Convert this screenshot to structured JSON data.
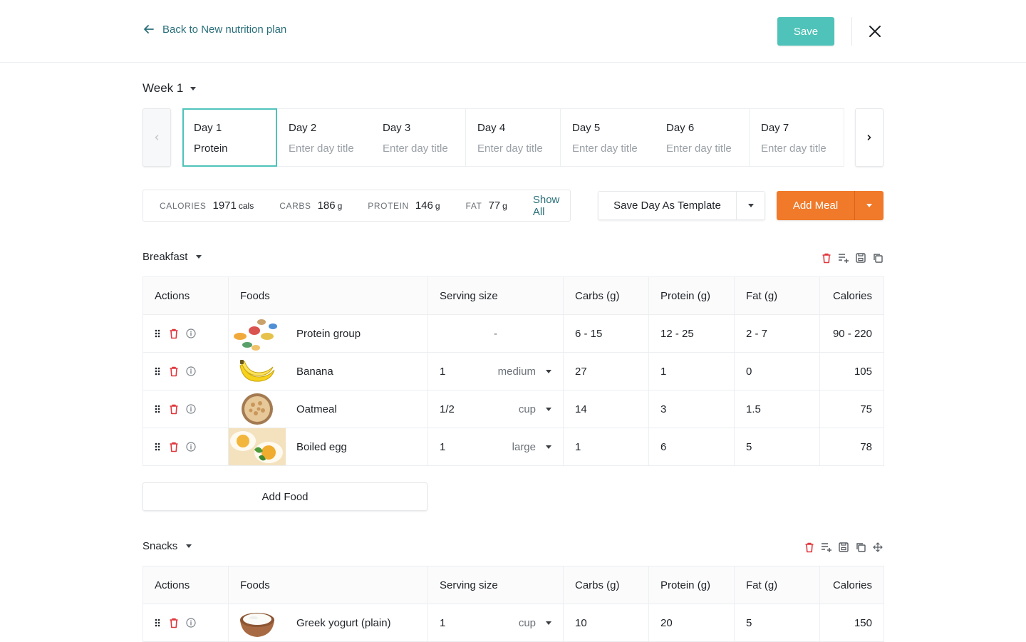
{
  "header": {
    "back_label": "Back to New nutrition plan",
    "save_label": "Save"
  },
  "week": {
    "label": "Week 1"
  },
  "days": [
    {
      "name": "Day 1",
      "title": "Protein",
      "active": true
    },
    {
      "name": "Day 2",
      "title": "Enter day title"
    },
    {
      "name": "Day 3",
      "title": "Enter day title"
    },
    {
      "name": "Day 4",
      "title": "Enter day title"
    },
    {
      "name": "Day 5",
      "title": "Enter day title"
    },
    {
      "name": "Day 6",
      "title": "Enter day title"
    },
    {
      "name": "Day 7",
      "title": "Enter day title"
    }
  ],
  "macros": {
    "calories": {
      "label": "CALORIES",
      "value": "1971",
      "unit": "cals"
    },
    "carbs": {
      "label": "CARBS",
      "value": "186",
      "unit": "g"
    },
    "protein": {
      "label": "PROTEIN",
      "value": "146",
      "unit": "g"
    },
    "fat": {
      "label": "FAT",
      "value": "77",
      "unit": "g"
    },
    "show_all": "Show All"
  },
  "buttons": {
    "save_template": "Save Day As Template",
    "add_meal": "Add Meal",
    "add_food": "Add Food"
  },
  "columns": [
    "Actions",
    "Foods",
    "Serving size",
    "Carbs (g)",
    "Protein (g)",
    "Fat (g)",
    "Calories"
  ],
  "breakfast": {
    "title": "Breakfast",
    "rows": [
      {
        "food": "Protein group",
        "qty": "",
        "unit": "",
        "serving_dash": "-",
        "carbs": "6 - 15",
        "protein": "12 - 25",
        "fat": "2 - 7",
        "calories": "90 - 220"
      },
      {
        "food": "Banana",
        "qty": "1",
        "unit": "medium",
        "carbs": "27",
        "protein": "1",
        "fat": "0",
        "calories": "105"
      },
      {
        "food": "Oatmeal",
        "qty": "1/2",
        "unit": "cup",
        "carbs": "14",
        "protein": "3",
        "fat": "1.5",
        "calories": "75"
      },
      {
        "food": "Boiled egg",
        "qty": "1",
        "unit": "large",
        "carbs": "1",
        "protein": "6",
        "fat": "5",
        "calories": "78"
      }
    ]
  },
  "snacks": {
    "title": "Snacks",
    "rows": [
      {
        "food": "Greek yogurt (plain)",
        "qty": "1",
        "unit": "cup",
        "carbs": "10",
        "protein": "20",
        "fat": "5",
        "calories": "150"
      }
    ]
  },
  "colors": {
    "teal": "#4fc3b9",
    "link": "#2a6f7a",
    "orange": "#f07a2a",
    "delete_red": "#e0383e"
  }
}
